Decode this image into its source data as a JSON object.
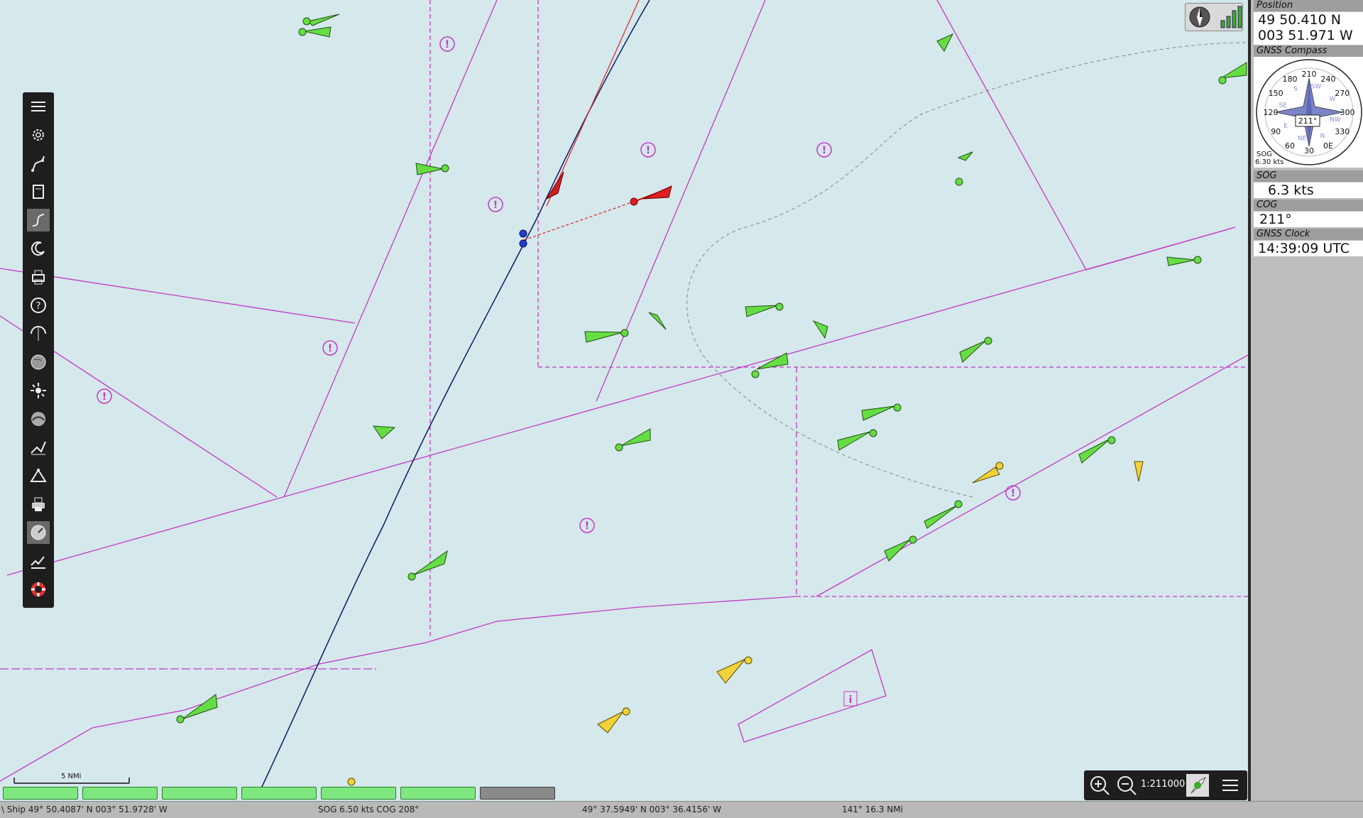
{
  "dashboard": {
    "position": {
      "title": "Position",
      "lat": "49 50.410 N",
      "lon": "003 51.971 W"
    },
    "compass": {
      "title": "GNSS Compass",
      "heading_label": "211°",
      "sog_line1": "SOG",
      "sog_line2": "6.30 kts",
      "dial_labels": [
        "210",
        "240",
        "270",
        "300",
        "330",
        "0E",
        "30",
        "60",
        "90",
        "120",
        "150",
        "180"
      ],
      "cardinals": [
        "SW",
        "W",
        "NW",
        "N",
        "NE",
        "E",
        "SE",
        "S"
      ]
    },
    "sog": {
      "title": "SOG",
      "value": "6.3 kts"
    },
    "cog": {
      "title": "COG",
      "value": "211°"
    },
    "clock": {
      "title": "GNSS Clock",
      "value": "14:39:09 UTC"
    }
  },
  "toolbar": {
    "buttons": [
      "menu-icon",
      "settings-icon",
      "route-icon",
      "document-icon",
      "track-icon",
      "night-mode-icon",
      "print-icon",
      "help-icon",
      "ais-icon",
      "globe-icon",
      "sun-icon",
      "tide-icon",
      "route-manager-icon",
      "waypoint-icon",
      "printer-icon",
      "dashboard-icon",
      "logbook-icon",
      "lifebuoy-icon"
    ],
    "active": [
      "track-icon",
      "dashboard-icon"
    ]
  },
  "zoom": {
    "scale": "1:211000"
  },
  "scale_bar": {
    "label": "5 NMi"
  },
  "piano": {
    "keys": 7,
    "inactive_index": 6
  },
  "status_bar": {
    "ship": "\\ Ship 49° 50.4087' N   003° 51.9728' W",
    "sog_cog": "SOG 6.50 kts  COG 208°",
    "cursor": "49° 37.5949' N   003° 36.4156' W",
    "bearing": "141°  16.3 NMi"
  },
  "colors": {
    "sea": "#d5e8ec",
    "traffic_lane": "#c43ac4",
    "ais_green": "#66dd44",
    "ais_yellow": "#f2d23a",
    "own_ship": "#d02020",
    "track": "#0b1a66"
  }
}
